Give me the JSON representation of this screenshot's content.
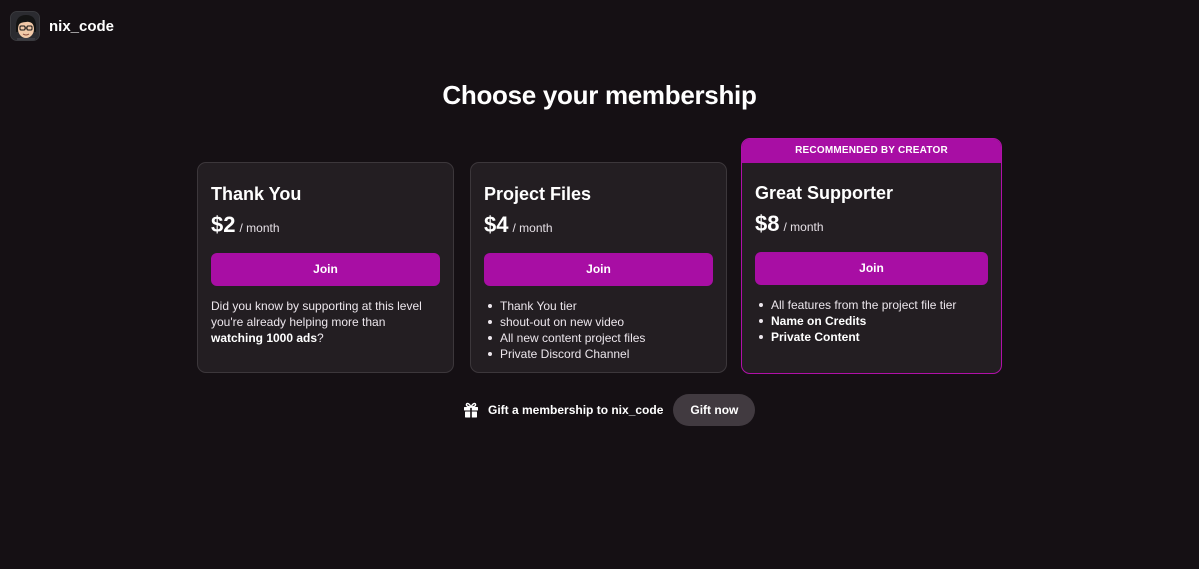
{
  "header": {
    "creator_name": "nix_code",
    "avatar_icon": "avatar-icon"
  },
  "page_title": "Choose your membership",
  "colors": {
    "background": "#151014",
    "card": "#231e22",
    "accent": "#a80ea4",
    "gift_button": "#413a40"
  },
  "tiers": [
    {
      "name": "Thank You",
      "price": "$2",
      "period": "/ month",
      "join_label": "Join",
      "description_prefix": "Did you know by supporting at this level you're already helping more than ",
      "description_bold": "watching 1000 ads",
      "description_suffix": "?"
    },
    {
      "name": "Project Files",
      "price": "$4",
      "period": "/ month",
      "join_label": "Join",
      "benefits": [
        "Thank You tier",
        "shout-out on new video",
        "All new content project files",
        "Private Discord Channel"
      ]
    },
    {
      "badge": "RECOMMENDED BY CREATOR",
      "name": "Great Supporter",
      "price": "$8",
      "period": "/ month",
      "join_label": "Join",
      "benefits": [
        "All features from the project file tier",
        "Name on Credits",
        "Private Content"
      ]
    }
  ],
  "gift": {
    "icon": "gift-icon",
    "text": "Gift a membership to nix_code",
    "button_label": "Gift now"
  }
}
